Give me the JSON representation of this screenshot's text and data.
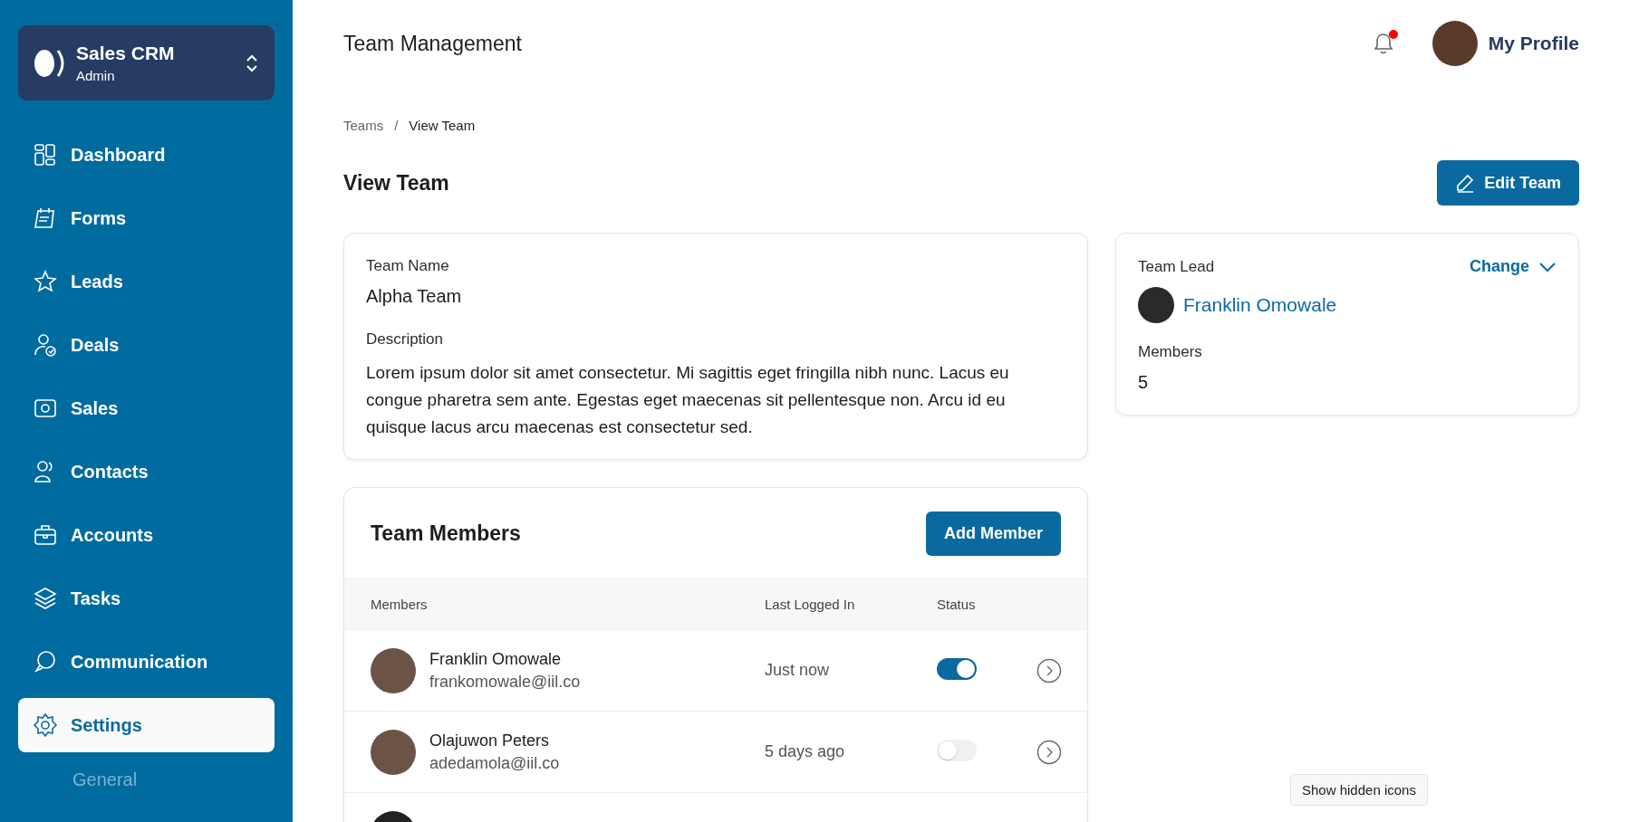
{
  "sidebar": {
    "brand": {
      "name": "Sales CRM",
      "role": "Admin"
    },
    "items": [
      {
        "label": "Dashboard",
        "selected": false
      },
      {
        "label": "Forms",
        "selected": false
      },
      {
        "label": "Leads",
        "selected": false
      },
      {
        "label": "Deals",
        "selected": false
      },
      {
        "label": "Sales",
        "selected": false
      },
      {
        "label": "Contacts",
        "selected": false
      },
      {
        "label": "Accounts",
        "selected": false
      },
      {
        "label": "Tasks",
        "selected": false
      },
      {
        "label": "Communication",
        "selected": false
      },
      {
        "label": "Settings",
        "selected": true,
        "children": [
          {
            "label": "General",
            "selected": false
          }
        ]
      }
    ]
  },
  "header": {
    "title": "Team Management",
    "notification": {
      "unread": true
    },
    "profile": {
      "label": "My Profile"
    }
  },
  "breadcrumb": {
    "separator": "/",
    "items": [
      "Teams",
      "View Team"
    ]
  },
  "page": {
    "title": "View Team",
    "edit_button": "Edit Team"
  },
  "team": {
    "name_label": "Team Name",
    "name": "Alpha Team",
    "description_label": "Description",
    "description": "Lorem ipsum dolor sit amet consectetur. Mi sagittis eget fringilla nibh nunc. Lacus eu congue pharetra sem ante. Egestas eget maecenas sit pellentesque non. Arcu id eu quisque lacus arcu maecenas est consectetur sed."
  },
  "lead_card": {
    "label": "Team Lead",
    "change": "Change",
    "lead": "Franklin Omowale",
    "members_label": "Members",
    "members": "5"
  },
  "members_card": {
    "title": "Team Members",
    "add_button": "Add Member",
    "columns": [
      "Members",
      "Last Logged In",
      "Status"
    ],
    "rows": [
      {
        "name": "Franklin Omowale",
        "email": "frankomowale@iil.co",
        "last": "Just now",
        "on": true
      },
      {
        "name": "Olajuwon Peters",
        "email": "adedamola@iil.co",
        "last": "5 days ago",
        "on": false
      }
    ]
  },
  "tooltip": "Show hidden icons"
}
